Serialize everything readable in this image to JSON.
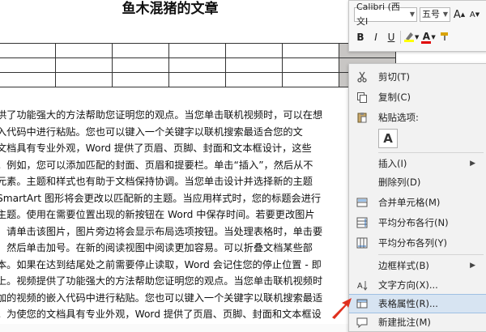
{
  "document": {
    "title": "鱼木混猪的文章",
    "paragraph_lines": [
      "供了功能强大的方法帮助您证明您的观点。当您单击联机视频时，可以在想",
      "入代码中进行粘贴。您也可以键入一个关键字以联机搜索最适合您的文",
      "文档具有专业外观，Word 提供了页眉、页脚、封面和文本框设计，这些",
      "。例如，您可以添加匹配的封面、页眉和提要栏。单击“插入”，然后从不",
      "元素。主题和样式也有助于文档保持协调。当您单击设计并选择新的主题",
      "SmartArt 图形将会更改以匹配新的主题。当应用样式时，您的标题会进行",
      "主题。使用在需要位置出现的新按钮在 Word 中保存时间。若要更改图片",
      "，请单击该图片，图片旁边将会显示布局选项按钮。当处理表格时，单击要",
      "，然后单击加号。在新的阅读视图中阅读更加容易。可以折叠文档某些部",
      "本。如果在达到结尾处之前需要停止读取，Word 会记住您的停止位置 - 即",
      "上。视频提供了功能强大的方法帮助您证明您的观点。当您单击联机视频时",
      "加的视频的嵌入代码中进行粘贴。您也可以键入一个关键字以联机搜索最适",
      "。为使您的文档具有专业外观，Word 提供了页眉、页脚、封面和文本框设"
    ]
  },
  "mini_toolbar": {
    "font_name": "Calibri (西文I",
    "font_size": "五号",
    "grow_font_label": "A",
    "shrink_font_label": "A",
    "bold_label": "B",
    "italic_label": "I",
    "underline_label": "U",
    "font_color_label": "A",
    "highlight_color": "#ffff00",
    "font_color": "#e00000"
  },
  "context_menu": {
    "items": [
      {
        "label": "剪切(T)",
        "icon": "scissors-icon"
      },
      {
        "label": "复制(C)",
        "icon": "copy-icon"
      },
      {
        "label": "粘贴选项:",
        "icon": "paste-icon"
      },
      {
        "label": "插入(I)",
        "icon": "none"
      },
      {
        "label": "删除列(D)",
        "icon": "none"
      },
      {
        "label": "合并单元格(M)",
        "icon": "merge-cells-icon"
      },
      {
        "label": "平均分布各行(N)",
        "icon": "distribute-rows-icon"
      },
      {
        "label": "平均分布各列(Y)",
        "icon": "distribute-columns-icon"
      },
      {
        "label": "边框样式(B)",
        "icon": "none"
      },
      {
        "label": "文字方向(X)...",
        "icon": "text-direction-icon"
      },
      {
        "label": "表格属性(R)...",
        "icon": "table-properties-icon"
      },
      {
        "label": "新建批注(M)",
        "icon": "new-comment-icon"
      }
    ],
    "paste_option_glyph": "A",
    "highlight_color": "#d7e4f2",
    "cursor_color": "#e0301e"
  }
}
